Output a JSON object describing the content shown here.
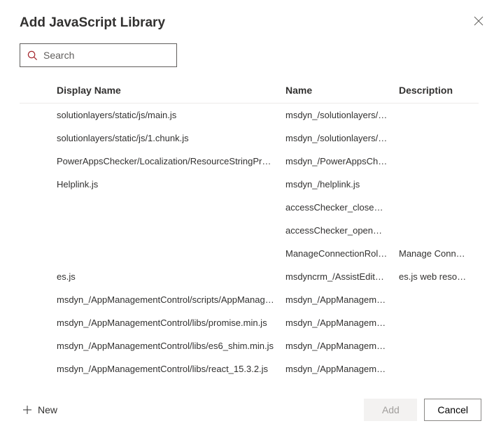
{
  "dialog": {
    "title": "Add JavaScript Library"
  },
  "search": {
    "placeholder": "Search",
    "value": ""
  },
  "table": {
    "headers": {
      "displayName": "Display Name",
      "name": "Name",
      "description": "Description"
    },
    "rows": [
      {
        "displayName": "solutionlayers/static/js/main.js",
        "name": "msdyn_/solutionlayers/sta...",
        "description": ""
      },
      {
        "displayName": "solutionlayers/static/js/1.chunk.js",
        "name": "msdyn_/solutionlayers/sta...",
        "description": ""
      },
      {
        "displayName": "PowerAppsChecker/Localization/ResourceStringProvid...",
        "name": "msdyn_/PowerAppsCheck...",
        "description": ""
      },
      {
        "displayName": "Helplink.js",
        "name": "msdyn_/helplink.js",
        "description": ""
      },
      {
        "displayName": "",
        "name": "accessChecker_closeDialo...",
        "description": ""
      },
      {
        "displayName": "",
        "name": "accessChecker_openDialo...",
        "description": ""
      },
      {
        "displayName": "",
        "name": "ManageConnectionRoles....",
        "description": "Manage Connect..."
      },
      {
        "displayName": "es.js",
        "name": "msdyncrm_/AssistEditCon...",
        "description": "es.js web resource."
      },
      {
        "displayName": "msdyn_/AppManagementControl/scripts/AppManage...",
        "name": "msdyn_/AppManagement...",
        "description": ""
      },
      {
        "displayName": "msdyn_/AppManagementControl/libs/promise.min.js",
        "name": "msdyn_/AppManagement...",
        "description": ""
      },
      {
        "displayName": "msdyn_/AppManagementControl/libs/es6_shim.min.js",
        "name": "msdyn_/AppManagement...",
        "description": ""
      },
      {
        "displayName": "msdyn_/AppManagementControl/libs/react_15.3.2.js",
        "name": "msdyn_/AppManagement...",
        "description": ""
      }
    ]
  },
  "footer": {
    "newLabel": "New",
    "addLabel": "Add",
    "cancelLabel": "Cancel"
  }
}
